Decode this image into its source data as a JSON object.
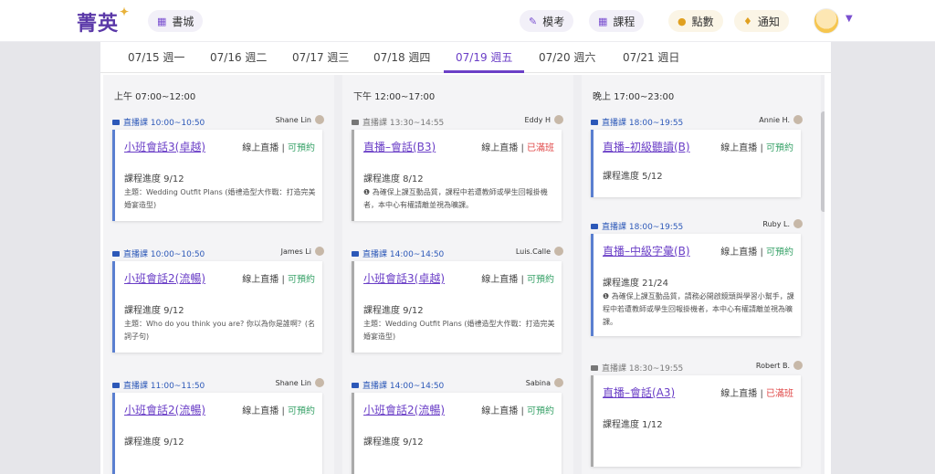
{
  "header": {
    "logo": "菁英",
    "nav": {
      "bookstore": "書城",
      "mock_exam": "模考",
      "courses": "課程",
      "points": "點數",
      "notifications": "通知"
    }
  },
  "tabs": [
    {
      "label": "07/15 週一",
      "active": false
    },
    {
      "label": "07/16 週二",
      "active": false
    },
    {
      "label": "07/17 週三",
      "active": false
    },
    {
      "label": "07/18 週四",
      "active": false
    },
    {
      "label": "07/19 週五",
      "active": true
    },
    {
      "label": "07/20 週六",
      "active": false
    },
    {
      "label": "07/21 週日",
      "active": false
    }
  ],
  "columns": [
    {
      "title": "上午 07:00~12:00",
      "sessions": [
        {
          "live": "直播課 10:00~10:50",
          "teacher": "Shane Lin",
          "title": "小班會話3(卓越)",
          "mode": "線上直播",
          "status": "可預約",
          "progress": "課程進度 9/12",
          "topic": "主題：Wedding Outfit Plans (婚禮造型大作戰：打造完美婚宴造型)"
        },
        {
          "live": "直播課 10:00~10:50",
          "teacher": "James Li",
          "title": "小班會話2(流暢)",
          "mode": "線上直播",
          "status": "可預約",
          "progress": "課程進度 9/12",
          "topic": "主題：Who do you think you are? 你以為你是誰啊？(名詞子句)"
        },
        {
          "live": "直播課 11:00~11:50",
          "teacher": "Shane Lin",
          "title": "小班會話2(流暢)",
          "mode": "線上直播",
          "status": "可預約",
          "progress": "課程進度 9/12",
          "topic": ""
        }
      ]
    },
    {
      "title": "下午 12:00~17:00",
      "sessions": [
        {
          "live": "直播課 13:30~14:55",
          "teacher": "Eddy H",
          "title": "直播–會話(B3)",
          "mode": "線上直播",
          "status": "已滿班",
          "progress": "課程進度 8/12",
          "topic": "❶ 為確保上課互動品質，課程中若遭教師或學生回報掛機者，本中心有權請離並視為曠課。"
        },
        {
          "live": "直播課 14:00~14:50",
          "teacher": "Luis.Calle",
          "title": "小班會話3(卓越)",
          "mode": "線上直播",
          "status": "可預約",
          "progress": "課程進度 9/12",
          "topic": "主題：Wedding Outfit Plans (婚禮造型大作戰：打造完美婚宴造型)"
        },
        {
          "live": "直播課 14:00~14:50",
          "teacher": "Sabina",
          "title": "小班會話2(流暢)",
          "mode": "線上直播",
          "status": "可預約",
          "progress": "課程進度 9/12",
          "topic": ""
        }
      ]
    },
    {
      "title": "晚上 17:00~23:00",
      "sessions": [
        {
          "live": "直播課 18:00~19:55",
          "teacher": "Annie H.",
          "title": "直播–初級聽讀(B)",
          "mode": "線上直播",
          "status": "可預約",
          "progress": "課程進度 5/12",
          "topic": ""
        },
        {
          "live": "直播課 18:00~19:55",
          "teacher": "Ruby L.",
          "title": "直播–中級字彙(B)",
          "mode": "線上直播",
          "status": "可預約",
          "progress": "課程進度 21/24",
          "topic": "❶ 為確保上課互動品質，請務必開啟鏡頭與學習小幫手，課程中若遭教師或學生回報掛機者，本中心有權請離並視為曠課。"
        },
        {
          "live": "直播課 18:30~19:55",
          "teacher": "Robert B.",
          "title": "直播–會話(A3)",
          "mode": "線上直播",
          "status": "已滿班",
          "progress": "課程進度 1/12",
          "topic": ""
        }
      ]
    }
  ],
  "colors": {
    "accent": "#6b3fc7",
    "live_blue": "#2c58b8",
    "available": "#3aa36a",
    "full": "#e04848"
  }
}
